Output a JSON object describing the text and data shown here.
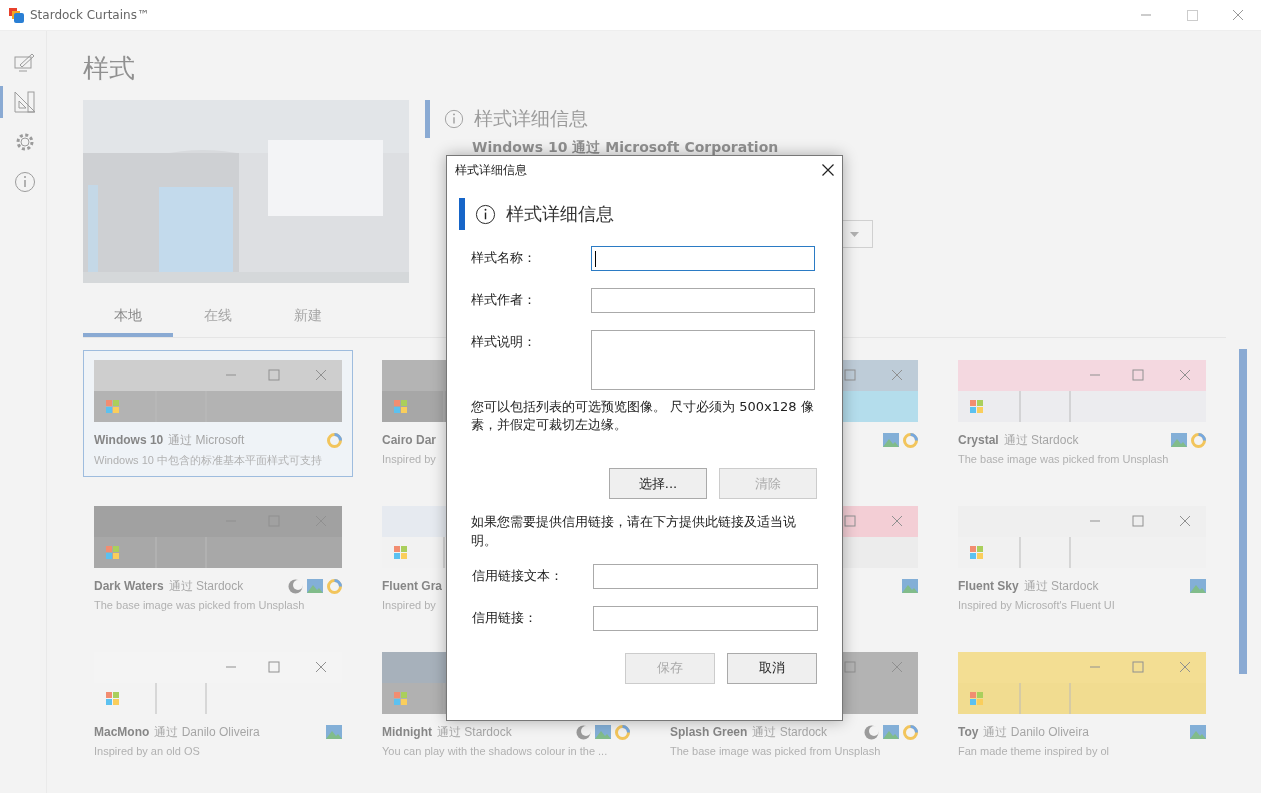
{
  "window": {
    "title": "Stardock Curtains™"
  },
  "sidebar": {
    "items": [
      {
        "kind": "edit",
        "selected": false
      },
      {
        "kind": "styles",
        "selected": true
      },
      {
        "kind": "settings",
        "selected": false
      },
      {
        "kind": "about",
        "selected": false
      }
    ]
  },
  "page": {
    "title": "样式",
    "details": {
      "heading": "样式详细信息",
      "byline": "Windows 10 通过 Microsoft Corporation"
    }
  },
  "tabs": [
    {
      "label": "本地",
      "selected": true
    },
    {
      "label": "在线",
      "selected": false
    },
    {
      "label": "新建",
      "selected": false
    }
  ],
  "styles": [
    {
      "name": "Windows 10",
      "author": "通过 Microsoft",
      "description": "Windows 10 中包含的标准基本平面样式可支持",
      "selected": true,
      "dark_mode": false,
      "wallpaper": false,
      "color_accent": true
    },
    {
      "name": "Cairo Dar",
      "description": "Inspired by",
      "selected": false,
      "dark_mode": false,
      "wallpaper": false,
      "color_accent": false
    },
    {
      "selected": false,
      "dark_mode": false,
      "wallpaper": true,
      "color_accent": true
    },
    {
      "name": "Crystal",
      "author": "通过 Stardock",
      "description": "The base image was picked from Unsplash",
      "selected": false,
      "dark_mode": false,
      "wallpaper": true,
      "color_accent": true
    },
    {
      "name": "Dark Waters",
      "author": "通过 Stardock",
      "description": "The base image was picked from Unsplash",
      "selected": false,
      "dark_mode": true,
      "wallpaper": true,
      "color_accent": true
    },
    {
      "name": "Fluent Gra",
      "description": "Inspired by",
      "selected": false,
      "dark_mode": false,
      "wallpaper": false,
      "color_accent": false
    },
    {
      "selected": false,
      "dark_mode": false,
      "wallpaper": true,
      "color_accent": false
    },
    {
      "name": "Fluent Sky",
      "author": "通过 Stardock",
      "description": "Inspired by Microsoft's Fluent UI",
      "selected": false,
      "dark_mode": false,
      "wallpaper": true,
      "color_accent": false
    },
    {
      "name": "MacMono",
      "author": "通过 Danilo Oliveira",
      "description": "Inspired by an old OS",
      "selected": false,
      "dark_mode": false,
      "wallpaper": true,
      "color_accent": false
    },
    {
      "name": "Midnight",
      "author": "通过 Stardock",
      "description": "You can play with the shadows colour in the ...",
      "selected": false,
      "dark_mode": true,
      "wallpaper": true,
      "color_accent": true
    },
    {
      "name": "Splash Green",
      "author": "通过 Stardock",
      "description": "The base image was picked from Unsplash",
      "selected": false,
      "dark_mode": true,
      "wallpaper": true,
      "color_accent": true
    },
    {
      "name": "Toy",
      "author": "通过 Danilo Oliveira",
      "description": "Fan made theme inspired by ol",
      "selected": false,
      "dark_mode": false,
      "wallpaper": true,
      "color_accent": false
    }
  ],
  "dialog": {
    "title": "样式详细信息",
    "heading": "样式详细信息",
    "fields": [
      {
        "label": "样式名称：",
        "kind": "line",
        "focused": true
      },
      {
        "label": "样式作者：",
        "kind": "line",
        "focused": false
      },
      {
        "label": "样式说明：",
        "kind": "multiline",
        "focused": false
      }
    ],
    "image_note": "您可以包括列表的可选预览图像。 尺寸必须为 500x128 像素，并假定可裁切左边缘。",
    "image_buttons": [
      {
        "label": "选择...",
        "disabled": false
      },
      {
        "label": "清除",
        "disabled": true
      }
    ],
    "credit_note": "如果您需要提供信用链接，请在下方提供此链接及适当说明。",
    "credit_fields": [
      {
        "label": "信用链接文本："
      },
      {
        "label": "信用链接："
      }
    ],
    "buttons": [
      {
        "label": "保存",
        "disabled": true
      },
      {
        "label": "取消",
        "disabled": false
      }
    ]
  }
}
